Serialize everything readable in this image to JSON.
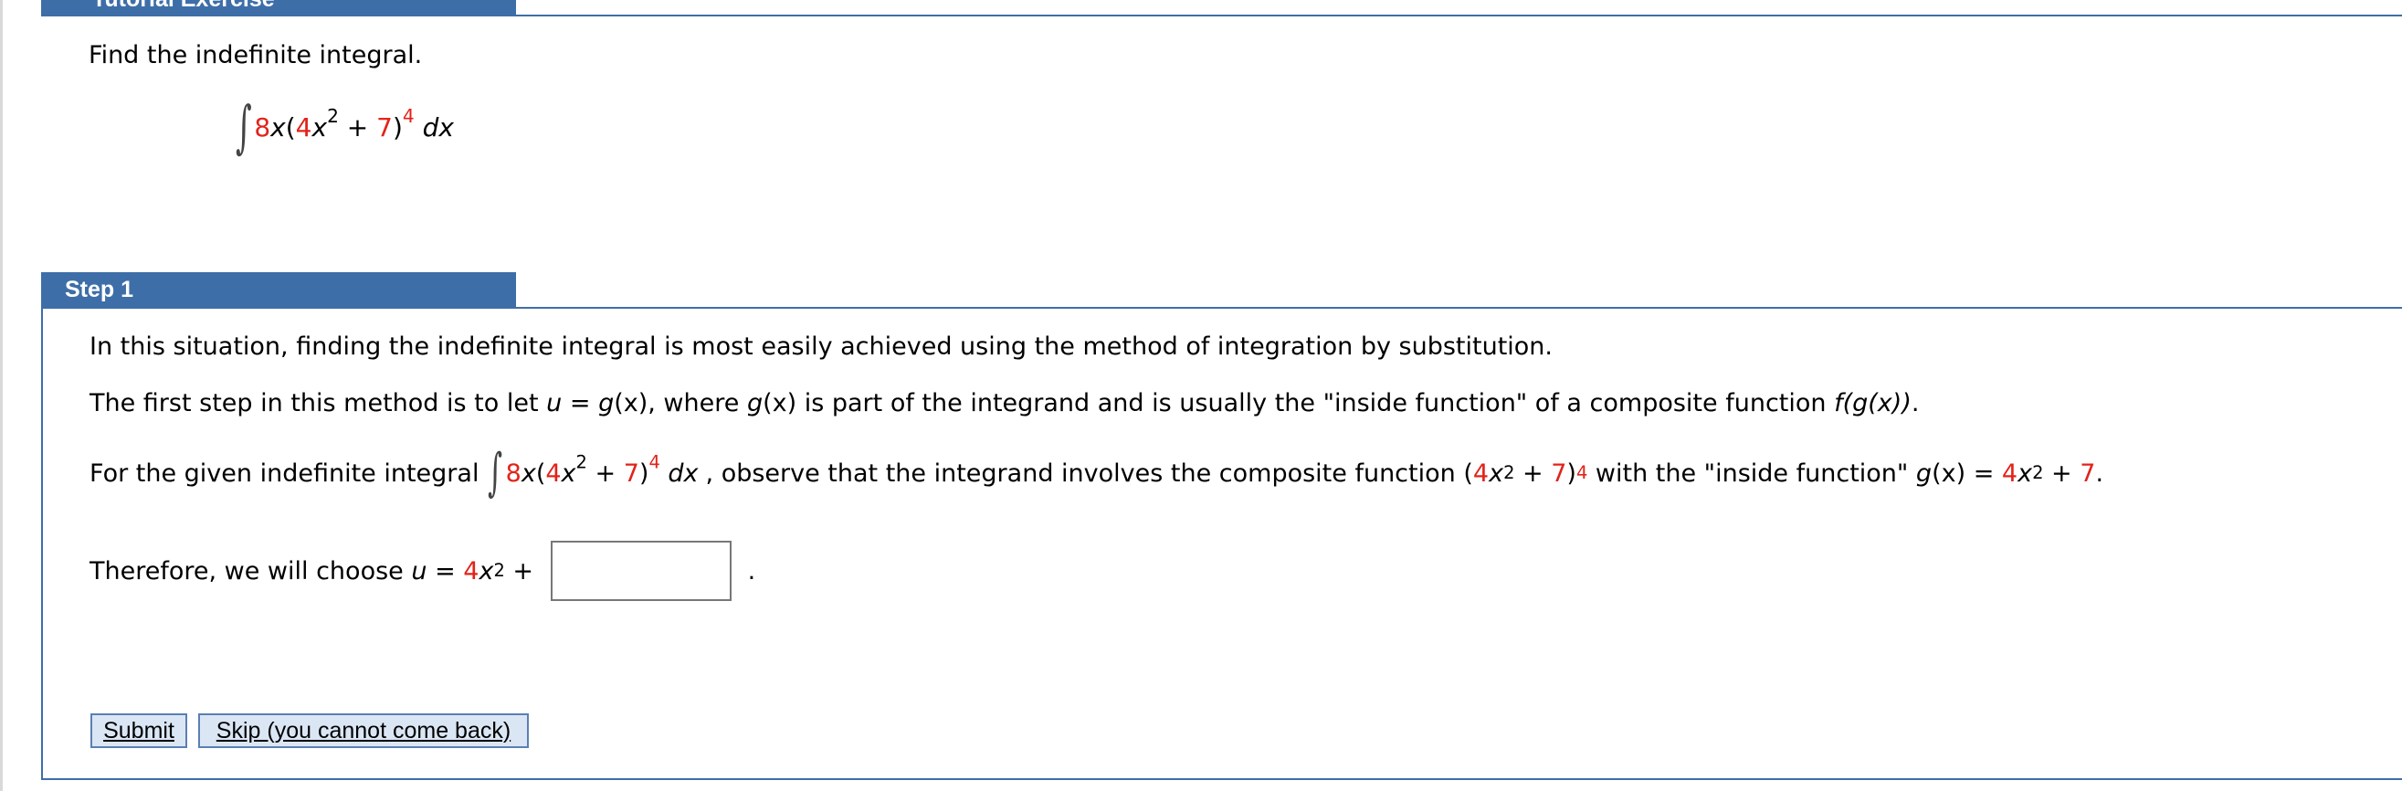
{
  "tutorial": {
    "title": "Tutorial Exercise"
  },
  "prompt": "Find the indefinite integral.",
  "integrand": {
    "coef": "8",
    "var_x": "x",
    "open": "(",
    "inner_coef": "4",
    "inner_var": "x",
    "inner_pow": "2",
    "plus": " + ",
    "const": "7",
    "close": ")",
    "outer_pow": "4",
    "dx": "dx"
  },
  "step1": {
    "label": "Step 1",
    "line1": "In this situation, finding the indefinite integral is most easily achieved using the method of integration by substitution.",
    "line2_a": "The first step in this method is to let ",
    "line2_u": "u",
    "line2_eq": " = ",
    "line2_g": "g",
    "line2_x": "(x)",
    "line2_b": ", where ",
    "line2_c": " is part of the integrand and is usually the \"inside function\" of a composite function ",
    "line2_f": "f(g(x))",
    "line2_end": ".",
    "line3_a": "For the given indefinite integral",
    "line3_b": ", observe that the integrand involves the composite function ",
    "line3_c": " with the \"inside function\" ",
    "line3_d": " = ",
    "line3_end": ".",
    "line4_a": "Therefore, we will choose ",
    "line4_u": "u",
    "line4_eq": " = ",
    "line4_plus": " + ",
    "line4_end": ".",
    "answer_value": ""
  },
  "buttons": {
    "submit": "Submit",
    "skip": "Skip (you cannot come back)"
  },
  "colors": {
    "header_blue": "#3e6ea8",
    "highlight_red": "#e2231a"
  }
}
